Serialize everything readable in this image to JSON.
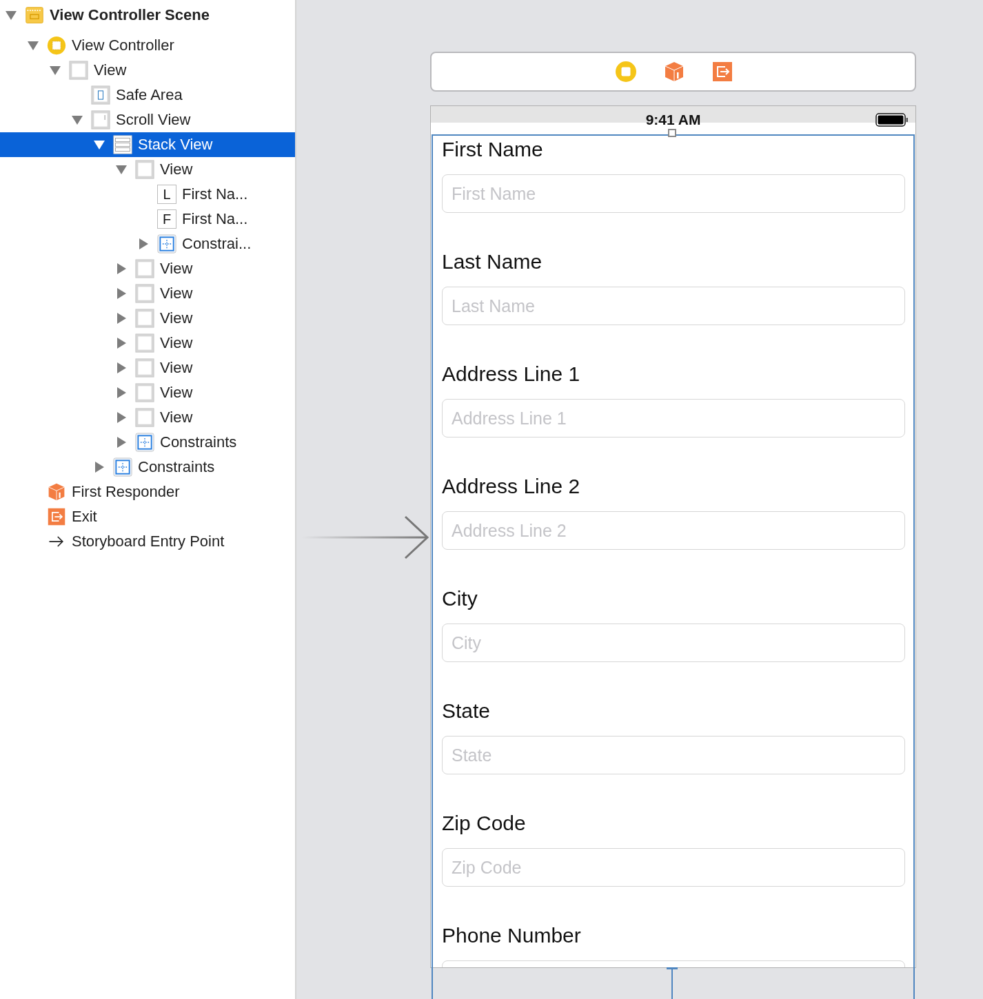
{
  "outline": [
    {
      "label": "View Controller Scene",
      "kind": "scene",
      "expanded": true,
      "selected": false,
      "children": [
        {
          "label": "View Controller",
          "kind": "controller",
          "expanded": true,
          "selected": false,
          "children": [
            {
              "label": "View",
              "kind": "view",
              "expanded": true,
              "selected": false,
              "children": [
                {
                  "label": "Safe Area",
                  "kind": "safe-area",
                  "selected": false
                },
                {
                  "label": "Scroll View",
                  "kind": "scroll-view",
                  "expanded": true,
                  "selected": false,
                  "children": [
                    {
                      "label": "Stack View",
                      "kind": "stack-view",
                      "expanded": true,
                      "selected": true,
                      "children": [
                        {
                          "label": "View",
                          "kind": "view",
                          "expanded": true,
                          "selected": false,
                          "children": [
                            {
                              "label": "First Na...",
                              "kind": "letter",
                              "glyph": "L",
                              "selected": false
                            },
                            {
                              "label": "First Na...",
                              "kind": "letter",
                              "glyph": "F",
                              "selected": false
                            },
                            {
                              "label": "Constrai...",
                              "kind": "constraints",
                              "expanded": false,
                              "selected": false
                            }
                          ]
                        },
                        {
                          "label": "View",
                          "kind": "view",
                          "expanded": false,
                          "selected": false
                        },
                        {
                          "label": "View",
                          "kind": "view",
                          "expanded": false,
                          "selected": false
                        },
                        {
                          "label": "View",
                          "kind": "view",
                          "expanded": false,
                          "selected": false
                        },
                        {
                          "label": "View",
                          "kind": "view",
                          "expanded": false,
                          "selected": false
                        },
                        {
                          "label": "View",
                          "kind": "view",
                          "expanded": false,
                          "selected": false
                        },
                        {
                          "label": "View",
                          "kind": "view",
                          "expanded": false,
                          "selected": false
                        },
                        {
                          "label": "View",
                          "kind": "view",
                          "expanded": false,
                          "selected": false
                        },
                        {
                          "label": "Constraints",
                          "kind": "constraints",
                          "expanded": false,
                          "selected": false
                        }
                      ]
                    },
                    {
                      "label": "Constraints",
                      "kind": "constraints",
                      "expanded": false,
                      "selected": false
                    }
                  ]
                }
              ]
            }
          ]
        },
        {
          "label": "First Responder",
          "kind": "responder",
          "selected": false
        },
        {
          "label": "Exit",
          "kind": "exit",
          "selected": false
        },
        {
          "label": "Storyboard Entry Point",
          "kind": "entry",
          "selected": false
        }
      ]
    }
  ],
  "phone": {
    "time": "9:41 AM",
    "form": [
      {
        "label": "First Name",
        "placeholder": "First Name"
      },
      {
        "label": "Last Name",
        "placeholder": "Last Name"
      },
      {
        "label": "Address Line 1",
        "placeholder": "Address Line 1"
      },
      {
        "label": "Address Line 2",
        "placeholder": "Address Line 2"
      },
      {
        "label": "City",
        "placeholder": "City"
      },
      {
        "label": "State",
        "placeholder": "State"
      },
      {
        "label": "Zip Code",
        "placeholder": "Zip Code"
      },
      {
        "label": "Phone Number"
      }
    ]
  }
}
